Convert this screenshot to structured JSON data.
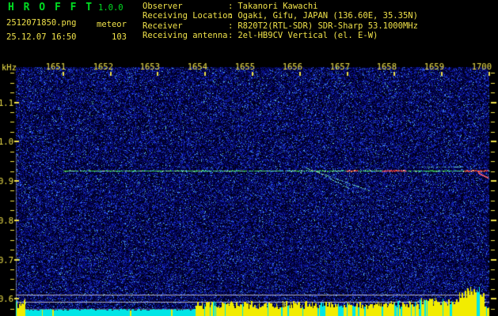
{
  "header": {
    "title": "H R O F F T",
    "version": "1.0.0",
    "filename": "2512071850.png",
    "mode": "meteor",
    "datetime": "25.12.07 16:50",
    "count": "103",
    "separator": ":",
    "info": [
      {
        "label": "Observer",
        "value": "Takanori Kawachi"
      },
      {
        "label": "Receiving Location",
        "value": "Ogaki, Gifu, JAPAN (136.60E, 35.35N)"
      },
      {
        "label": "Receiver",
        "value": "R820T2(RTL-SDR) SDR-Sharp 53.1000MHz"
      },
      {
        "label": "Receiving antenna",
        "value": "2el-HB9CV Vertical (el. E-W)"
      }
    ]
  },
  "colors": {
    "accent_green": "#00dd22",
    "text_yellow": "#f0e24a",
    "carrier_green": "#3ccf5a",
    "echo_cyan": "#6fdcd2",
    "burst_red": "#e03c3c",
    "strip_cyan": "#00e6e6",
    "strip_yellow": "#f2ec00",
    "ref_line_gray": "#d2d2dc"
  },
  "chart_data": {
    "type": "heatmap",
    "subtype": "radio-meteor-spectrogram",
    "title": "HROFFT 10-minute meteor echo spectrogram",
    "ylabel": "kHz",
    "xlabel": "",
    "x_tick_labels": [
      "1651",
      "1652",
      "1653",
      "1654",
      "1655",
      "1656",
      "1657",
      "1658",
      "1659",
      "1700"
    ],
    "y_tick_labels": [
      "1.1",
      "1.0",
      "0.9",
      "0.8",
      "0.7",
      "0.6"
    ],
    "y_tick_khz": [
      1.1,
      1.0,
      0.9,
      0.8,
      0.7,
      0.6
    ],
    "y_minor_step_khz": 0.025,
    "y_range_khz": [
      0.565,
      1.19
    ],
    "x_range_min": [
      0,
      10
    ],
    "grid": false,
    "legend": null,
    "background": "dark blue random noise speckle",
    "carrier_line": {
      "freq_khz": 0.926,
      "t_start_min": 1.0,
      "t_end_min": 10.0,
      "strong_red_segments_t": [
        [
          6.97,
          7.22
        ],
        [
          7.74,
          8.23
        ],
        [
          9.45,
          9.97
        ]
      ]
    },
    "meteor_echoes": [
      {
        "kind": "doppler-streak",
        "t1": 6.12,
        "f1": 0.934,
        "t2": 7.46,
        "f2": 0.876,
        "dotted": true
      },
      {
        "kind": "doppler-streak",
        "t1": 6.32,
        "f1": 0.926,
        "t2": 7.02,
        "f2": 0.882,
        "dotted": true
      },
      {
        "kind": "streak-above-carrier",
        "t1": 8.6,
        "f1": 0.937,
        "t2": 9.43,
        "f2": 0.936,
        "dotted": true
      },
      {
        "kind": "descending-tail",
        "t1": 9.77,
        "f1": 0.922,
        "t2": 9.97,
        "f2": 0.91,
        "dotted": false
      }
    ],
    "level_reference_lines_khz": [
      0.61,
      0.592,
      0.574
    ],
    "signal_strip": {
      "description": "bottom received-signal level graph, yellow bars over cyan base",
      "regions": [
        {
          "t1": 0.0,
          "t2": 0.2,
          "h_min": 10,
          "h_max": 24,
          "yellow_prob": 0.6
        },
        {
          "t1": 0.21,
          "t2": 3.74,
          "h_min": 7,
          "h_max": 9,
          "yellow_prob": 0.04
        },
        {
          "t1": 3.75,
          "t2": 8.51,
          "h_min": 9,
          "h_max": 19,
          "yellow_prob": 0.82
        },
        {
          "t1": 8.52,
          "t2": 9.35,
          "h_min": 13,
          "h_max": 23,
          "yellow_prob": 0.85
        },
        {
          "t1": 9.36,
          "t2": 9.87,
          "h_min": 22,
          "h_max": 38,
          "yellow_prob": 0.9
        },
        {
          "t1": 9.88,
          "t2": 10.0,
          "h_min": 8,
          "h_max": 16,
          "yellow_prob": 0.8
        }
      ]
    }
  }
}
